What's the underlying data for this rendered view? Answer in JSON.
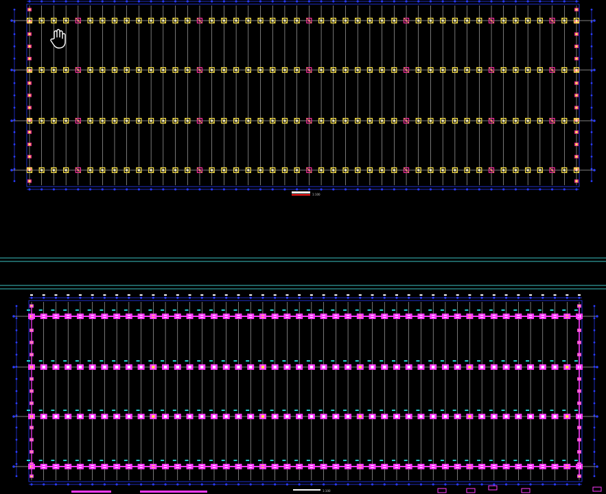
{
  "app": {
    "kind": "CAD drawing viewer"
  },
  "colors": {
    "background": "#000000",
    "grid_line": "#ffffff",
    "dimension": "#2a3cff",
    "column": "#ffe64a",
    "column_alt": "#ff2fa0",
    "foundation": "#ff3bff",
    "tag": "#22d6d6",
    "separator": "#3cc4c4",
    "red": "#ff2020"
  },
  "cursor": {
    "icon": "hand-pan-icon"
  },
  "plan_top": {
    "bays": 45,
    "rows": 4,
    "highlighted_bays": [
      4,
      14,
      23,
      31,
      38,
      43
    ]
  },
  "plan_bottom": {
    "bays": 45,
    "rows": 4,
    "highlighted_bays": [
      0,
      10,
      19,
      27,
      36,
      44
    ]
  },
  "title_block": {
    "top_label": "1:100",
    "bottom_label": "1:100"
  }
}
